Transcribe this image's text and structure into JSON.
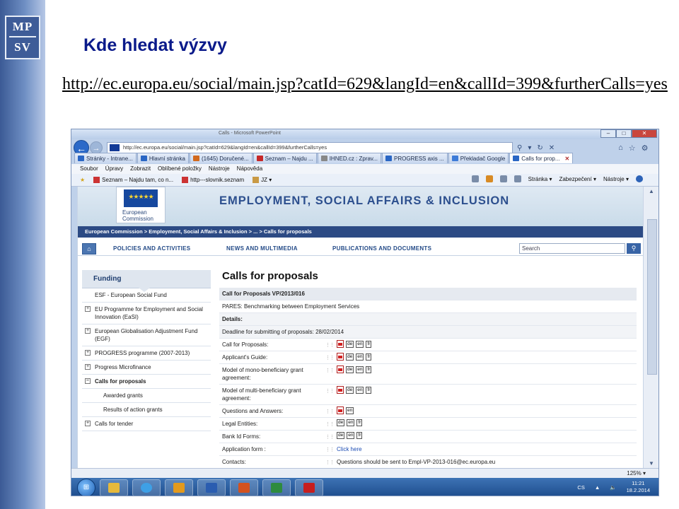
{
  "slide": {
    "logo_top": "MP",
    "logo_bottom": "SV",
    "title": "Kde hledat výzvy",
    "url": "http://ec.europa.eu/social/main.jsp?catId=629&langId=en&callId=399&furtherCalls=yes"
  },
  "browser": {
    "window_title": "Calls - Microsoft PowerPoint",
    "address": "http://ec.europa.eu/social/main.jsp?catId=629&langId=en&callId=399&furtherCalls=yes",
    "tabs": [
      {
        "label": "Stránky - Intrane..."
      },
      {
        "label": "Hlavní stránka"
      },
      {
        "label": "(1645) Doručené..."
      },
      {
        "label": "Seznam – Najdu ..."
      },
      {
        "label": "IHNED.cz : Zprav..."
      },
      {
        "label": "PROGRESS axis ..."
      },
      {
        "label": "Překladač Google"
      },
      {
        "label": "Calls for prop..."
      }
    ],
    "menu": [
      "Soubor",
      "Úpravy",
      "Zobrazit",
      "Oblíbené položky",
      "Nástroje",
      "Nápověda"
    ],
    "favorites": [
      "Seznam – Najdu tam, co n...",
      "http---slovnik.seznam",
      "JZ ▾"
    ],
    "fav_right": [
      "Stránka ▾",
      "Zabezpečení ▾",
      "Nástroje ▾"
    ],
    "zoom": "125%"
  },
  "page": {
    "logo_line1": "European",
    "logo_line2": "Commission",
    "header_title": "EMPLOYMENT, SOCIAL AFFAIRS & INCLUSION",
    "breadcrumb": "European Commission > Employment, Social Affairs & Inclusion > ... > Calls for proposals",
    "nav": [
      "POLICIES AND ACTIVITIES",
      "NEWS AND MULTIMEDIA",
      "PUBLICATIONS AND DOCUMENTS"
    ],
    "search_placeholder": "Search",
    "sidebar": {
      "title": "Funding",
      "items": [
        {
          "label": "ESF - European Social Fund"
        },
        {
          "label": "EU Programme for Employment and Social Innovation (EaSI)"
        },
        {
          "label": "European Globalisation Adjustment Fund (EGF)"
        },
        {
          "label": "PROGRESS programme (2007-2013)"
        },
        {
          "label": "Progress Microfinance"
        },
        {
          "label": "Calls for proposals"
        },
        {
          "label": "Awarded grants"
        },
        {
          "label": "Results of action grants"
        },
        {
          "label": "Calls for tender"
        }
      ]
    },
    "content": {
      "title": "Calls for proposals",
      "call_ref": "Call for Proposals VP/2013/016",
      "call_name": "PARES: Benchmarking between Employment Services",
      "details_label": "Details:",
      "deadline": "Deadline for submitting of proposals: 28/02/2014",
      "rows": [
        {
          "label": "Call for Proposals:"
        },
        {
          "label": "Applicant's Guide:"
        },
        {
          "label": "Model of mono-beneficiary grant agreement:"
        },
        {
          "label": "Model of multi-beneficiary grant agreement:"
        },
        {
          "label": "Questions and Answers:"
        },
        {
          "label": "Legal Entities:"
        },
        {
          "label": "Bank Id Forms:"
        },
        {
          "label": "Application form :"
        },
        {
          "label": "Contacts:"
        }
      ],
      "lang_de": "de",
      "lang_en": "en",
      "lang_fr": "fr",
      "click_here": "Click here",
      "contacts_text": "Questions should be sent to Empl-VP-2013-016@ec.europa.eu"
    }
  },
  "taskbar": {
    "lang": "CS",
    "time": "11:21",
    "date": "18.2.2014"
  }
}
